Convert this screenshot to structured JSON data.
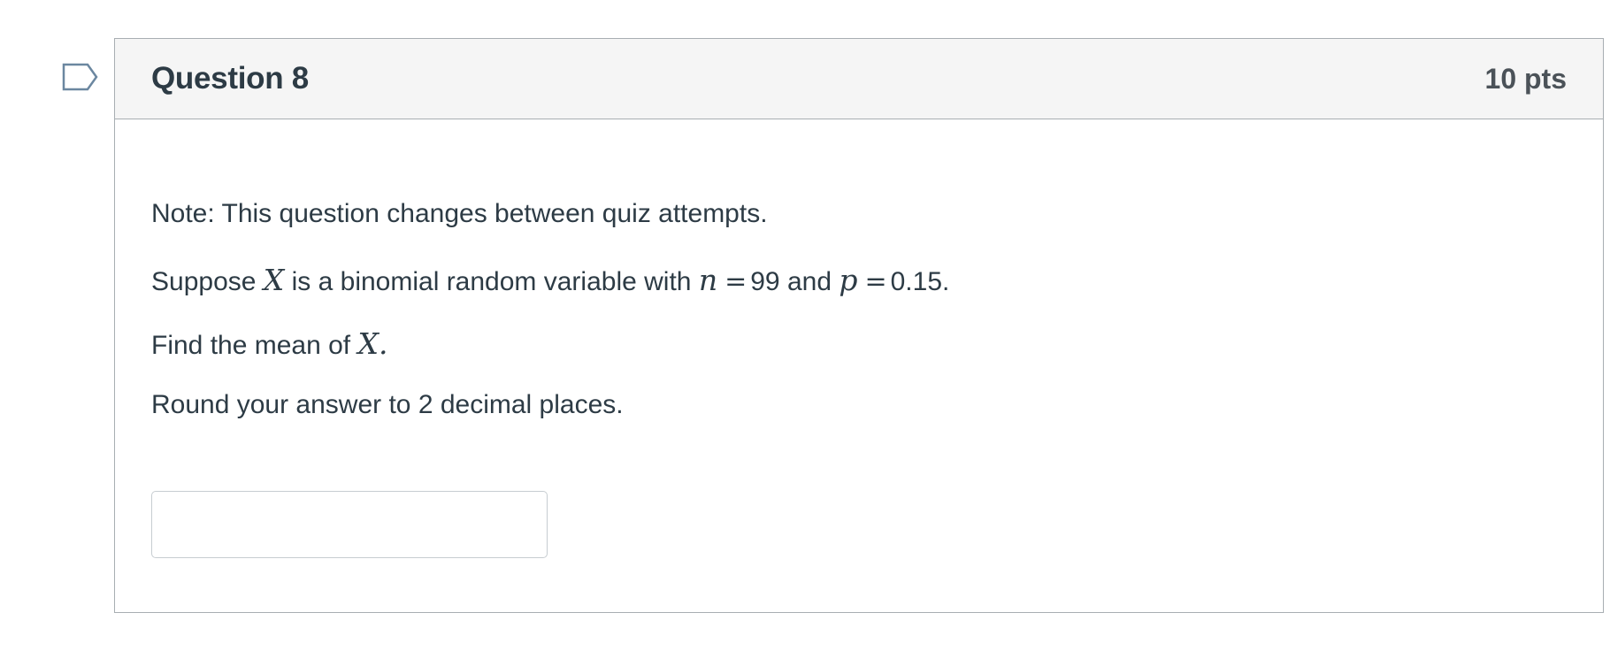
{
  "flag": {
    "icon": "flag-outline-icon",
    "color": "#6b87a0"
  },
  "question": {
    "title": "Question 8",
    "points": "10 pts",
    "note": "Note: This question changes between quiz attempts.",
    "line2": {
      "pre": "Suppose ",
      "var_x": "X",
      "mid1": " is a binomial random variable with ",
      "var_n": "n",
      "eq1": "=",
      "n_value": "99",
      "mid2": " and ",
      "var_p": "p",
      "eq2": "=",
      "p_value": "0.15."
    },
    "line3": {
      "pre": "Find the mean of ",
      "var_x": "X",
      "post": "."
    },
    "instructions": "Round your answer to 2 decimal places.",
    "answer": {
      "value": "",
      "placeholder": ""
    }
  },
  "colors": {
    "header_bg": "#f5f5f5",
    "border": "#a8aeb2",
    "text": "#2d3b45"
  }
}
